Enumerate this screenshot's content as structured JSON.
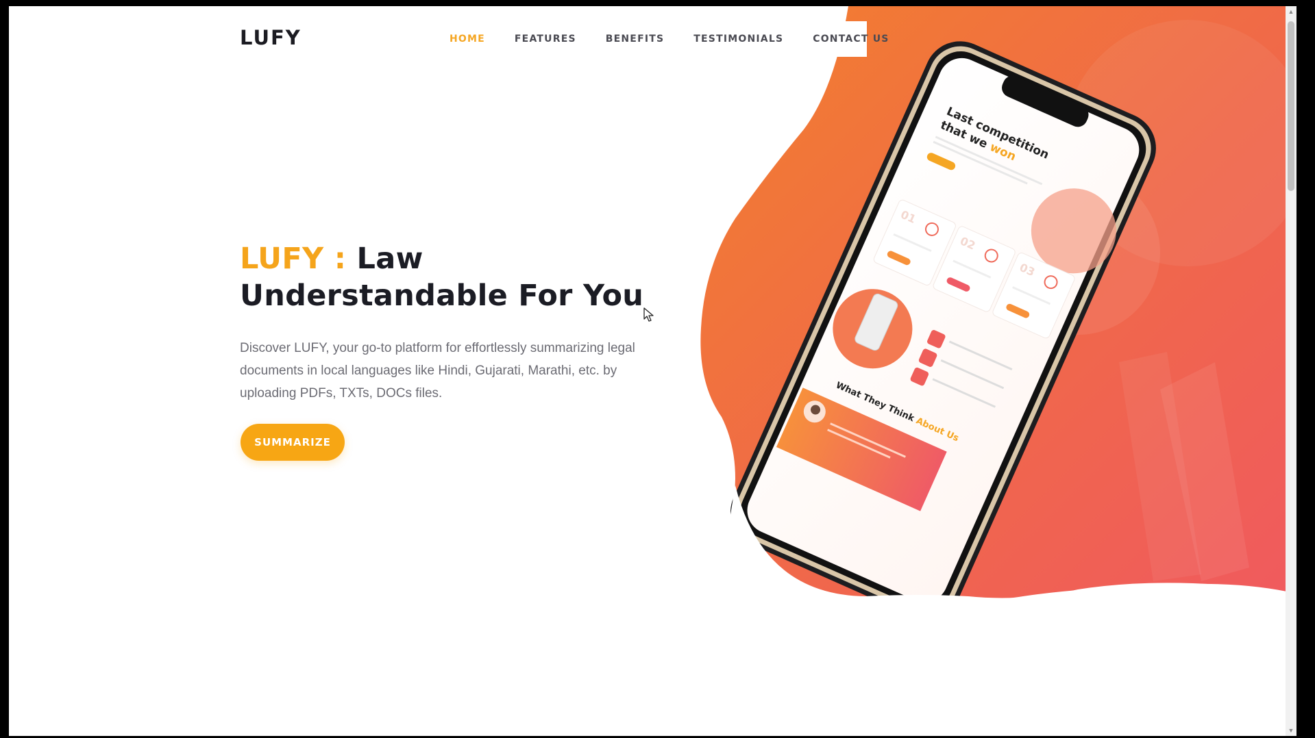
{
  "logo": "LUFY",
  "nav": {
    "items": [
      "HOME",
      "FEATURES",
      "BENEFITS",
      "TESTIMONIALS",
      "CONTACT US"
    ],
    "active_index": 0
  },
  "hero": {
    "title_accent": "LUFY :",
    "title_rest_line1": "Law",
    "title_line2": "Understandable For You",
    "description": "Discover LUFY, your go-to platform for effortlessly summarizing legal documents in local languages like Hindi, Gujarati, Marathi, etc. by uploading PDFs, TXTs, DOCs files.",
    "cta_label": "SUMMARIZE"
  },
  "phone_mockup": {
    "headline_line1": "Last competition",
    "headline_line2_a": "that we",
    "headline_line2_b": "won",
    "cards": [
      "01",
      "02",
      "03"
    ],
    "testimonial_a": "What They Think",
    "testimonial_b": "About Us"
  },
  "colors": {
    "accent": "#f5a623",
    "button": "#f7a614",
    "hero_gradient_start": "#f1813d",
    "hero_gradient_end": "#f25a5a",
    "text_dark": "#1b1c24",
    "text_muted": "#6b6b73"
  }
}
